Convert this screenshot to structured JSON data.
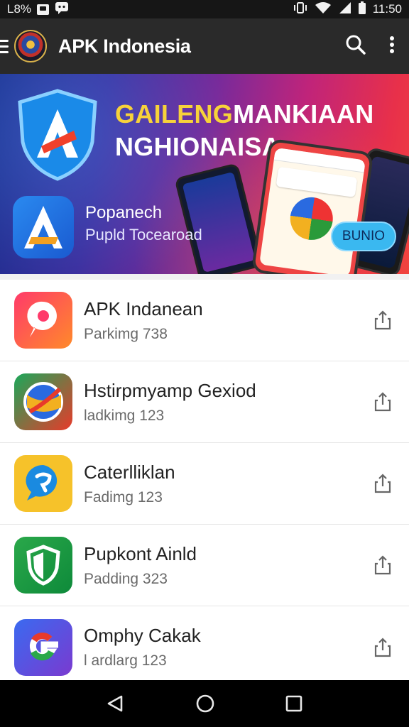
{
  "status_bar": {
    "left_text": "L8%",
    "time": "11:50",
    "icons": [
      "notification-box-icon",
      "chat-icon",
      "vibrate-icon",
      "wifi-icon",
      "signal-icon",
      "battery-icon"
    ]
  },
  "app_bar": {
    "title": "APK Indonesia",
    "icons": [
      "menu-icon",
      "emblem-logo",
      "search-icon",
      "more-vert-icon"
    ]
  },
  "banner": {
    "headline_part1": "GAILENG",
    "headline_part2": "MANKIAAN",
    "headline_line2": "NGHIONAISA",
    "promo_title": "Popanech",
    "promo_subtitle": "Pupld Tocearoad",
    "button_label": "BUNIO",
    "colors": {
      "headline_yellow": "#f7d23a",
      "button": "#3ab8f0"
    }
  },
  "apps": [
    {
      "title": "APK Indanean",
      "subtitle": "Parkimg 738",
      "icon": "location-chat-icon"
    },
    {
      "title": "Hstirpmyamp Gexiod",
      "subtitle": "ladkimg 123",
      "icon": "swirl-ball-icon"
    },
    {
      "title": "Caterlliklan",
      "subtitle": "Fadimg 123",
      "icon": "chat-bubble-icon"
    },
    {
      "title": "Pupkont Ainld",
      "subtitle": "Padding 323",
      "icon": "shield-icon"
    },
    {
      "title": "Omphy Cakak",
      "subtitle": "l ardlarg 123",
      "icon": "google-g-icon"
    }
  ],
  "nav_bar": {
    "icons": [
      "back-icon",
      "home-icon",
      "recents-icon"
    ]
  }
}
